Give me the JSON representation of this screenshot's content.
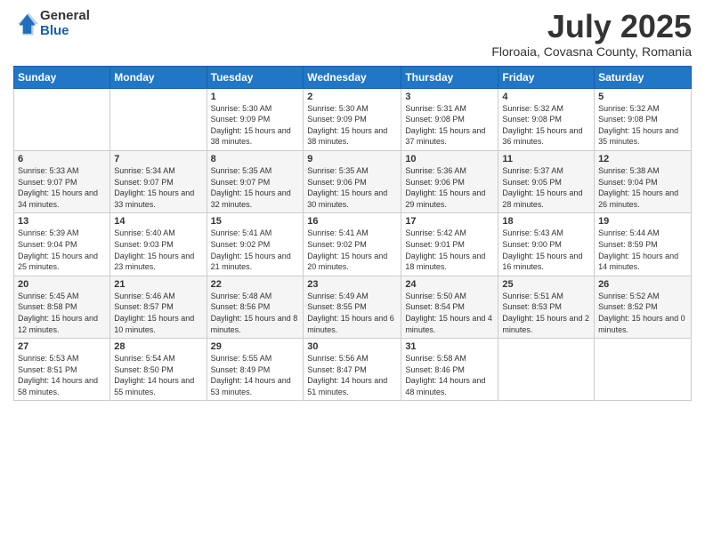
{
  "logo": {
    "general": "General",
    "blue": "Blue"
  },
  "header": {
    "month": "July 2025",
    "location": "Floroaia, Covasna County, Romania"
  },
  "weekdays": [
    "Sunday",
    "Monday",
    "Tuesday",
    "Wednesday",
    "Thursday",
    "Friday",
    "Saturday"
  ],
  "weeks": [
    [
      {
        "day": "",
        "info": ""
      },
      {
        "day": "",
        "info": ""
      },
      {
        "day": "1",
        "info": "Sunrise: 5:30 AM\nSunset: 9:09 PM\nDaylight: 15 hours and 38 minutes."
      },
      {
        "day": "2",
        "info": "Sunrise: 5:30 AM\nSunset: 9:09 PM\nDaylight: 15 hours and 38 minutes."
      },
      {
        "day": "3",
        "info": "Sunrise: 5:31 AM\nSunset: 9:08 PM\nDaylight: 15 hours and 37 minutes."
      },
      {
        "day": "4",
        "info": "Sunrise: 5:32 AM\nSunset: 9:08 PM\nDaylight: 15 hours and 36 minutes."
      },
      {
        "day": "5",
        "info": "Sunrise: 5:32 AM\nSunset: 9:08 PM\nDaylight: 15 hours and 35 minutes."
      }
    ],
    [
      {
        "day": "6",
        "info": "Sunrise: 5:33 AM\nSunset: 9:07 PM\nDaylight: 15 hours and 34 minutes."
      },
      {
        "day": "7",
        "info": "Sunrise: 5:34 AM\nSunset: 9:07 PM\nDaylight: 15 hours and 33 minutes."
      },
      {
        "day": "8",
        "info": "Sunrise: 5:35 AM\nSunset: 9:07 PM\nDaylight: 15 hours and 32 minutes."
      },
      {
        "day": "9",
        "info": "Sunrise: 5:35 AM\nSunset: 9:06 PM\nDaylight: 15 hours and 30 minutes."
      },
      {
        "day": "10",
        "info": "Sunrise: 5:36 AM\nSunset: 9:06 PM\nDaylight: 15 hours and 29 minutes."
      },
      {
        "day": "11",
        "info": "Sunrise: 5:37 AM\nSunset: 9:05 PM\nDaylight: 15 hours and 28 minutes."
      },
      {
        "day": "12",
        "info": "Sunrise: 5:38 AM\nSunset: 9:04 PM\nDaylight: 15 hours and 26 minutes."
      }
    ],
    [
      {
        "day": "13",
        "info": "Sunrise: 5:39 AM\nSunset: 9:04 PM\nDaylight: 15 hours and 25 minutes."
      },
      {
        "day": "14",
        "info": "Sunrise: 5:40 AM\nSunset: 9:03 PM\nDaylight: 15 hours and 23 minutes."
      },
      {
        "day": "15",
        "info": "Sunrise: 5:41 AM\nSunset: 9:02 PM\nDaylight: 15 hours and 21 minutes."
      },
      {
        "day": "16",
        "info": "Sunrise: 5:41 AM\nSunset: 9:02 PM\nDaylight: 15 hours and 20 minutes."
      },
      {
        "day": "17",
        "info": "Sunrise: 5:42 AM\nSunset: 9:01 PM\nDaylight: 15 hours and 18 minutes."
      },
      {
        "day": "18",
        "info": "Sunrise: 5:43 AM\nSunset: 9:00 PM\nDaylight: 15 hours and 16 minutes."
      },
      {
        "day": "19",
        "info": "Sunrise: 5:44 AM\nSunset: 8:59 PM\nDaylight: 15 hours and 14 minutes."
      }
    ],
    [
      {
        "day": "20",
        "info": "Sunrise: 5:45 AM\nSunset: 8:58 PM\nDaylight: 15 hours and 12 minutes."
      },
      {
        "day": "21",
        "info": "Sunrise: 5:46 AM\nSunset: 8:57 PM\nDaylight: 15 hours and 10 minutes."
      },
      {
        "day": "22",
        "info": "Sunrise: 5:48 AM\nSunset: 8:56 PM\nDaylight: 15 hours and 8 minutes."
      },
      {
        "day": "23",
        "info": "Sunrise: 5:49 AM\nSunset: 8:55 PM\nDaylight: 15 hours and 6 minutes."
      },
      {
        "day": "24",
        "info": "Sunrise: 5:50 AM\nSunset: 8:54 PM\nDaylight: 15 hours and 4 minutes."
      },
      {
        "day": "25",
        "info": "Sunrise: 5:51 AM\nSunset: 8:53 PM\nDaylight: 15 hours and 2 minutes."
      },
      {
        "day": "26",
        "info": "Sunrise: 5:52 AM\nSunset: 8:52 PM\nDaylight: 15 hours and 0 minutes."
      }
    ],
    [
      {
        "day": "27",
        "info": "Sunrise: 5:53 AM\nSunset: 8:51 PM\nDaylight: 14 hours and 58 minutes."
      },
      {
        "day": "28",
        "info": "Sunrise: 5:54 AM\nSunset: 8:50 PM\nDaylight: 14 hours and 55 minutes."
      },
      {
        "day": "29",
        "info": "Sunrise: 5:55 AM\nSunset: 8:49 PM\nDaylight: 14 hours and 53 minutes."
      },
      {
        "day": "30",
        "info": "Sunrise: 5:56 AM\nSunset: 8:47 PM\nDaylight: 14 hours and 51 minutes."
      },
      {
        "day": "31",
        "info": "Sunrise: 5:58 AM\nSunset: 8:46 PM\nDaylight: 14 hours and 48 minutes."
      },
      {
        "day": "",
        "info": ""
      },
      {
        "day": "",
        "info": ""
      }
    ]
  ]
}
